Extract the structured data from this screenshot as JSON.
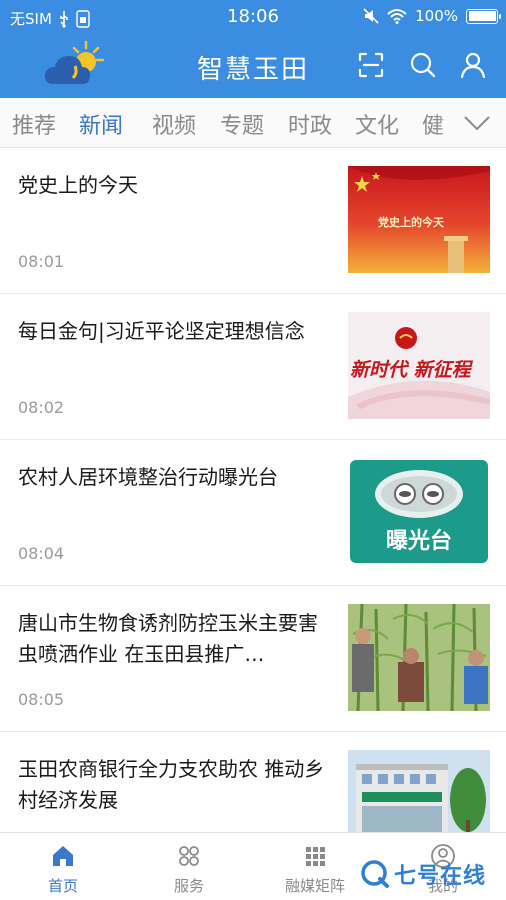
{
  "status_bar": {
    "carrier": "无SIM",
    "time": "18:06",
    "battery_text": "100%",
    "battery_level": 1.0
  },
  "header": {
    "title": "智慧玉田",
    "brand_color": "#3a8de0",
    "icons": [
      "weather-logo",
      "scan-icon",
      "search-icon",
      "user-icon"
    ]
  },
  "tabs": {
    "items": [
      "推荐",
      "新闻",
      "视频",
      "专题",
      "时政",
      "文化",
      "健"
    ],
    "active_index": 1,
    "active_color": "#3a78c9"
  },
  "news": [
    {
      "title": "党史上的今天",
      "time": "08:01",
      "image": "党史上的今天"
    },
    {
      "title": "每日金句|习近平论坚定理想信念",
      "time": "08:02",
      "image": "新时代 新征程"
    },
    {
      "title": "农村人居环境整治行动曝光台",
      "time": "08:04",
      "image": "曝光台"
    },
    {
      "title": "唐山市生物食诱剂防控玉米主要害虫喷洒作业 在玉田县推广…",
      "time": "08:05",
      "image": ""
    },
    {
      "title": "玉田农商银行全力支农助农 推动乡村经济发展",
      "time": "",
      "image": ""
    }
  ],
  "bottom_nav": {
    "items": [
      "首页",
      "服务",
      "融媒矩阵",
      "我的"
    ],
    "active_index": 0
  },
  "watermark": {
    "text": "七号在线"
  }
}
